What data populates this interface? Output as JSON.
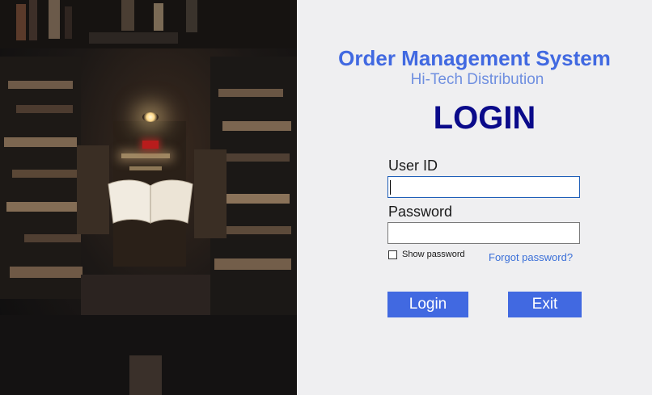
{
  "app": {
    "title": "Order Management System",
    "subtitle": "Hi-Tech Distribution",
    "heading": "LOGIN"
  },
  "form": {
    "user_id_label": "User ID",
    "user_id_value": "",
    "password_label": "Password",
    "password_value": "",
    "show_password_label": "Show password",
    "show_password_checked": false,
    "forgot_password_label": "Forgot password?"
  },
  "buttons": {
    "login_label": "Login",
    "exit_label": "Exit"
  },
  "colors": {
    "accent": "#4169e1",
    "heading": "#0a0a8a",
    "background": "#efeff1"
  },
  "hero_image": {
    "icon": "library-books-image"
  }
}
